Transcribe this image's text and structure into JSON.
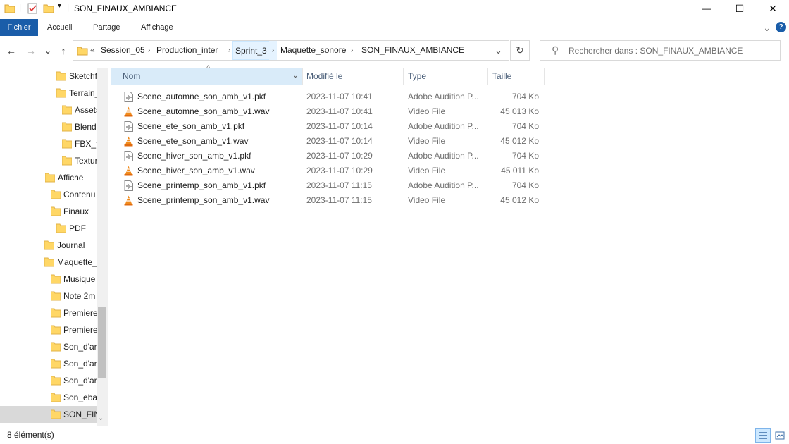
{
  "window": {
    "title": "SON_FINAUX_AMBIANCE",
    "minimize_glyph": "—",
    "maximize_glyph": "☐",
    "close_glyph": "✕"
  },
  "ribbon": {
    "tabs": [
      "Fichier",
      "Accueil",
      "Partage",
      "Affichage"
    ],
    "expand_glyph": "⌄",
    "help_glyph": "?"
  },
  "nav": {
    "back_glyph": "←",
    "forward_glyph": "→",
    "recent_glyph": "⌄",
    "up_glyph": "↑"
  },
  "address": {
    "overflow": "«",
    "crumbs": [
      "Session_05",
      "Production_inter",
      "Sprint_3",
      "Maquette_sonore",
      "SON_FINAUX_AMBIANCE"
    ],
    "separator": "›",
    "dropdown_glyph": "⌄",
    "refresh_glyph": "↻"
  },
  "search": {
    "placeholder": "Rechercher dans : SON_FINAUX_AMBIANCE",
    "icon_glyph": "⚲"
  },
  "tree": {
    "items": [
      {
        "label": "Sketchf"
      },
      {
        "label": "Terrain_"
      },
      {
        "label": "Assets"
      },
      {
        "label": "Blend"
      },
      {
        "label": "FBX_f"
      },
      {
        "label": "Textur"
      },
      {
        "label": "Affiche"
      },
      {
        "label": "Contenu"
      },
      {
        "label": "Finaux"
      },
      {
        "label": "PDF"
      },
      {
        "label": "Journal"
      },
      {
        "label": "Maquette_"
      },
      {
        "label": "Musique"
      },
      {
        "label": "Note 2m"
      },
      {
        "label": "Premiere"
      },
      {
        "label": "Premiere"
      },
      {
        "label": "Son_d'ar"
      },
      {
        "label": "Son_d'ar"
      },
      {
        "label": "Son_d'ar"
      },
      {
        "label": "Son_ebau"
      },
      {
        "label": "SON_FIN"
      }
    ]
  },
  "columns": {
    "name": "Nom",
    "date": "Modifié le",
    "type": "Type",
    "size": "Taille",
    "sort_glyph": "^",
    "filter_glyph": "⌄"
  },
  "files": [
    {
      "name": "Scene_automne_son_amb_v1.pkf",
      "date": "2023-11-07 10:41",
      "type": "Adobe Audition P...",
      "size": "704 Ko",
      "icon": "pkf-file-icon"
    },
    {
      "name": "Scene_automne_son_amb_v1.wav",
      "date": "2023-11-07 10:41",
      "type": "Video File",
      "size": "45 013 Ko",
      "icon": "vlc-cone-icon"
    },
    {
      "name": "Scene_ete_son_amb_v1.pkf",
      "date": "2023-11-07 10:14",
      "type": "Adobe Audition P...",
      "size": "704 Ko",
      "icon": "pkf-file-icon"
    },
    {
      "name": "Scene_ete_son_amb_v1.wav",
      "date": "2023-11-07 10:14",
      "type": "Video File",
      "size": "45 012 Ko",
      "icon": "vlc-cone-icon"
    },
    {
      "name": "Scene_hiver_son_amb_v1.pkf",
      "date": "2023-11-07 10:29",
      "type": "Adobe Audition P...",
      "size": "704 Ko",
      "icon": "pkf-file-icon"
    },
    {
      "name": "Scene_hiver_son_amb_v1.wav",
      "date": "2023-11-07 10:29",
      "type": "Video File",
      "size": "45 011 Ko",
      "icon": "vlc-cone-icon"
    },
    {
      "name": "Scene_printemp_son_amb_v1.pkf",
      "date": "2023-11-07 11:15",
      "type": "Adobe Audition P...",
      "size": "704 Ko",
      "icon": "pkf-file-icon"
    },
    {
      "name": "Scene_printemp_son_amb_v1.wav",
      "date": "2023-11-07 11:15",
      "type": "Video File",
      "size": "45 012 Ko",
      "icon": "vlc-cone-icon"
    }
  ],
  "status": {
    "count": "8 élément(s)"
  },
  "colors": {
    "accent": "#1a5da9",
    "folder": "#ffd766",
    "selected": "#cce8ff",
    "vlc": "#f08a1c"
  }
}
